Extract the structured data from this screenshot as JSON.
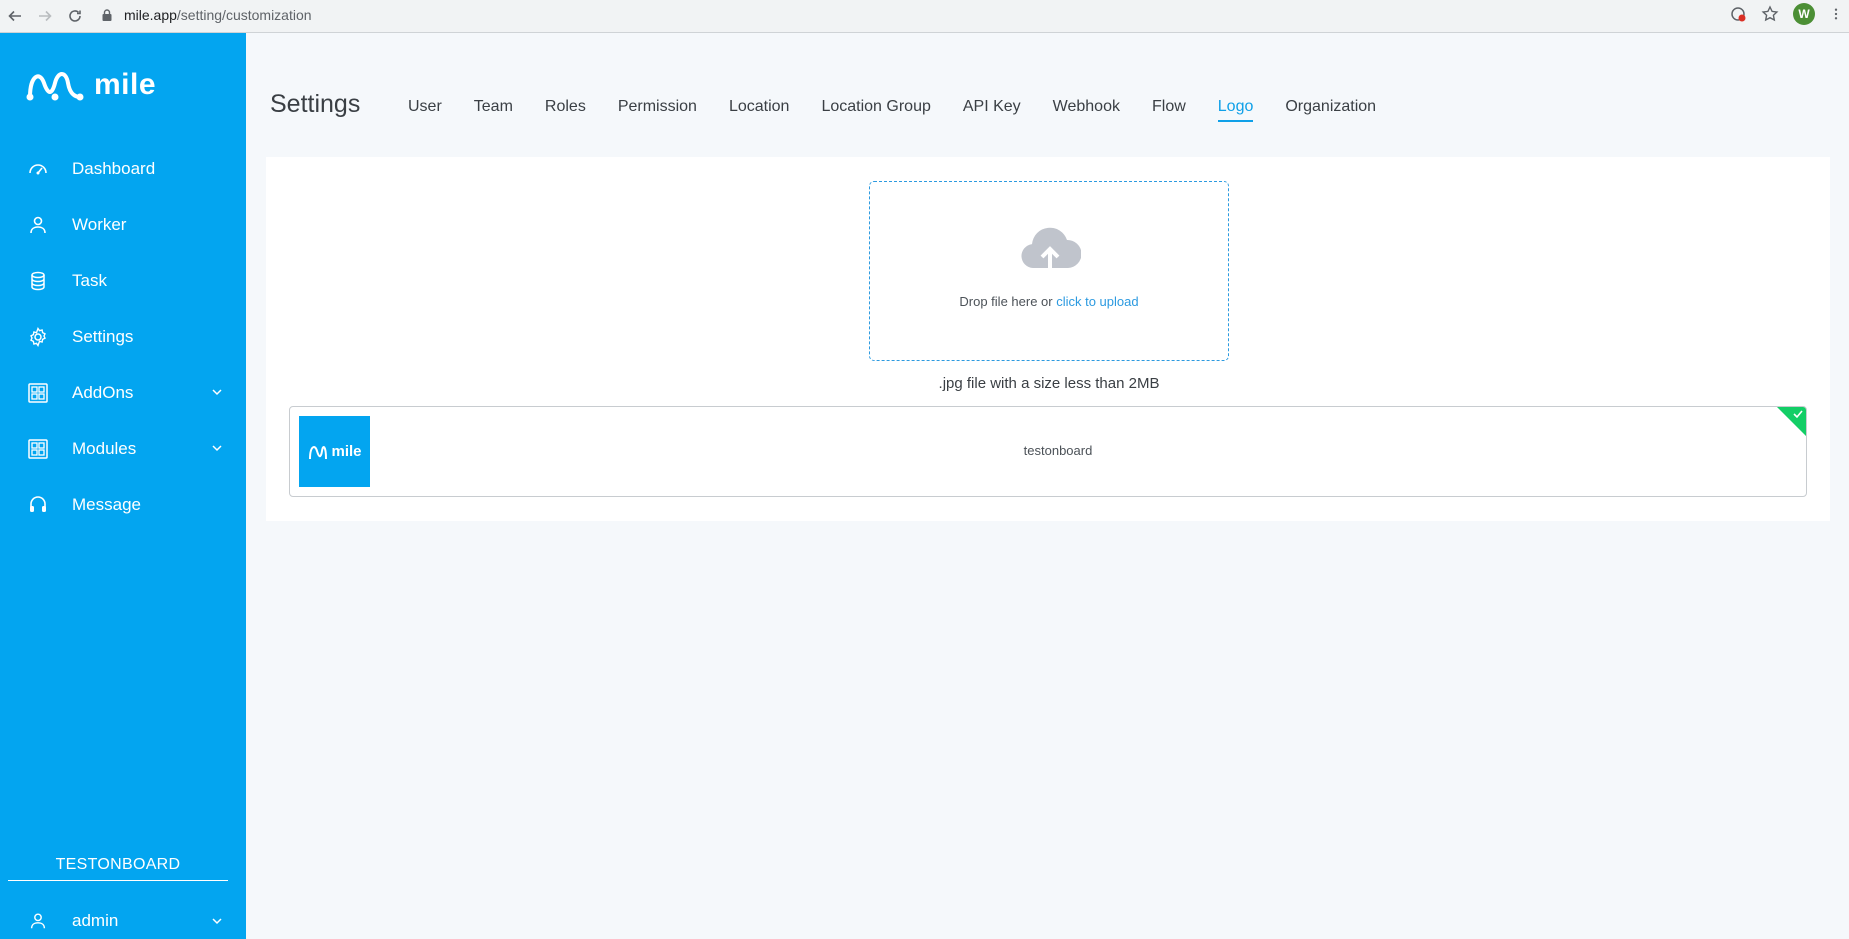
{
  "browser": {
    "url_host": "mile.app",
    "url_path": "/setting/customization",
    "profile_initial": "W"
  },
  "sidebar": {
    "brand": "mile",
    "items": [
      {
        "label": "Dashboard",
        "icon": "speedometer-icon"
      },
      {
        "label": "Worker",
        "icon": "person-icon"
      },
      {
        "label": "Task",
        "icon": "database-icon"
      },
      {
        "label": "Settings",
        "icon": "gear-icon"
      },
      {
        "label": "AddOns",
        "icon": "grid-icon",
        "expandable": true
      },
      {
        "label": "Modules",
        "icon": "grid-icon",
        "expandable": true
      },
      {
        "label": "Message",
        "icon": "headset-icon"
      }
    ],
    "org_name": "TESTONBOARD",
    "user": "admin"
  },
  "header": {
    "title": "Settings",
    "tabs": [
      {
        "label": "User"
      },
      {
        "label": "Team"
      },
      {
        "label": "Roles"
      },
      {
        "label": "Permission"
      },
      {
        "label": "Location"
      },
      {
        "label": "Location Group"
      },
      {
        "label": "API Key"
      },
      {
        "label": "Webhook"
      },
      {
        "label": "Flow"
      },
      {
        "label": "Logo",
        "active": true
      },
      {
        "label": "Organization"
      }
    ]
  },
  "upload": {
    "drop_text": "Drop file here or ",
    "link_text": "click to upload",
    "hint": ".jpg file with a size less than 2MB"
  },
  "file": {
    "thumb_word": "mile",
    "name": "testonboard",
    "status": "success"
  },
  "colors": {
    "sidebar": "#03a5f0",
    "accent": "#0fa0e8",
    "success": "#13ce66"
  }
}
